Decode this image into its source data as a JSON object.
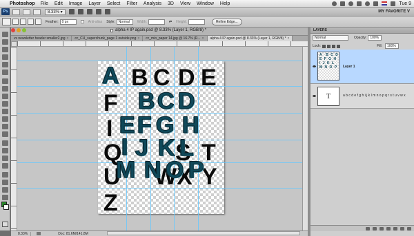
{
  "menubar": {
    "apple": "",
    "app": "Photoshop",
    "items": [
      "File",
      "Edit",
      "Image",
      "Layer",
      "Select",
      "Filter",
      "Analysis",
      "3D",
      "View",
      "Window",
      "Help"
    ],
    "clock": "Tue 9"
  },
  "appbar": {
    "logo": "Ps",
    "zoom": "8.33% ▾",
    "workspace": "MY FAVORITE V"
  },
  "options": {
    "feather_label": "Feather:",
    "feather_value": "0 px",
    "antialias_label": "Anti-alias",
    "style_label": "Style:",
    "style_value": "Normal",
    "width_label": "Width:",
    "height_label": "Height:",
    "refine_label": "Refine Edge..."
  },
  "document": {
    "title": "alpha 4 IP again.psd @ 8.33% (Layer 1, RGB/8) *",
    "tabs": [
      {
        "label": "vs newsletter header smaller2.jpg",
        "active": false
      },
      {
        "label": "cc_CU_superchunk_page 1 outside.png",
        "active": false
      },
      {
        "label": "cc_mio_paper 14.jpg @ 16.7% (R...",
        "active": false
      },
      {
        "label": "alpha 4 IP again.psd @ 8.33% (Layer 1, RGB/8) *",
        "active": true
      }
    ],
    "status_zoom": "8.33%",
    "status_doc": "Doc: 81.6M/141.8M"
  },
  "canvas": {
    "black_letters": [
      "A",
      "B",
      "C",
      "D",
      "E",
      "F",
      "I",
      "J",
      "Q",
      "R",
      "S",
      "T",
      "U",
      "V",
      "W",
      "X",
      "Y",
      "Z"
    ],
    "teal_letters": [
      "A",
      "B",
      "C",
      "D",
      "E",
      "F",
      "G",
      "H",
      "I",
      "J",
      "K",
      "L",
      "M",
      "N",
      "O",
      "P"
    ]
  },
  "layers": {
    "title": "LAYERS",
    "blend": "Normal",
    "opacity_label": "Opacity:",
    "opacity": "100%",
    "lock_label": "Lock:",
    "fill_label": "Fill:",
    "fill": "100%",
    "items": [
      {
        "name": "Layer 1",
        "thumb": "A  B C D\nE F G H\nI J K L\nM N O P",
        "selected": true
      },
      {
        "name": "a b c d e f g h i j k l m n o p q r s t u v w x",
        "thumb": "T",
        "selected": false
      }
    ]
  }
}
